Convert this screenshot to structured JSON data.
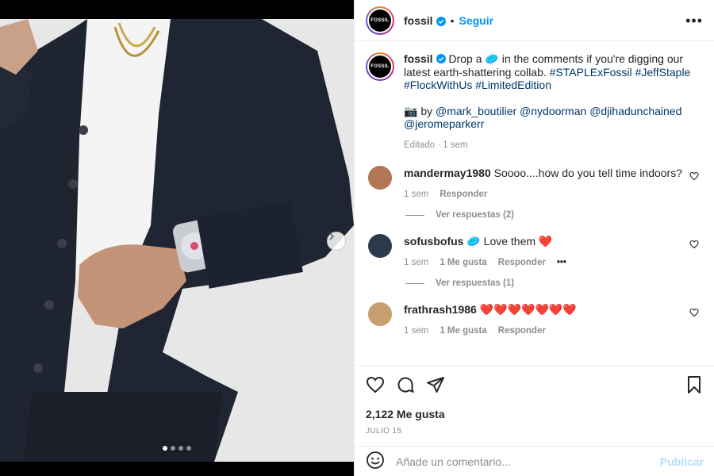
{
  "post": {
    "username": "fossil",
    "follow_label": "Seguir",
    "separator": "•",
    "avatar_logo_text": "FOSSIL",
    "more_label": "•••"
  },
  "caption": {
    "username": "fossil",
    "text_1": " Drop a ",
    "emoji": "🥏",
    "text_2": " in the comments if you're digging our latest earth-shattering collab. ",
    "hashtags": [
      "#STAPLExFossil",
      "#JeffStaple",
      "#FlockWithUs",
      "#LimitedEdition"
    ],
    "credit_prefix": "📷 by ",
    "mentions": [
      "@mark_boutilier",
      "@nydoorman",
      "@djihadunchained",
      "@jeromeparkerr"
    ],
    "meta": "Editado · 1 sem"
  },
  "comments": [
    {
      "username": "mandermay1980",
      "text": " Soooo....how do you tell time indoors?",
      "time": "1 sem",
      "likes": "",
      "reply": "Responder",
      "replies_label": "Ver respuestas (2)",
      "avatar_color": "#b07656"
    },
    {
      "username": "sofusbofus",
      "text": " 🥏 Love them ❤️",
      "time": "1 sem",
      "likes": "1 Me gusta",
      "reply": "Responder",
      "more": "•••",
      "replies_label": "Ver respuestas (1)",
      "avatar_color": "#2a3a4a"
    },
    {
      "username": "frathrash1986",
      "text": " ❤️❤️❤️❤️❤️❤️❤️",
      "time": "1 sem",
      "likes": "1 Me gusta",
      "reply": "Responder",
      "avatar_color": "#c8a070"
    }
  ],
  "footer": {
    "likes": "2,122 Me gusta",
    "date": "JULIO 15",
    "comment_placeholder": "Añade un comentario...",
    "publish_label": "Publicar"
  },
  "colors": {
    "link": "#00376b",
    "follow": "#0095f6",
    "publish_disabled": "#b2dffc",
    "muted": "#8e8e8e"
  },
  "carousel": {
    "count": 4,
    "active": 1
  }
}
